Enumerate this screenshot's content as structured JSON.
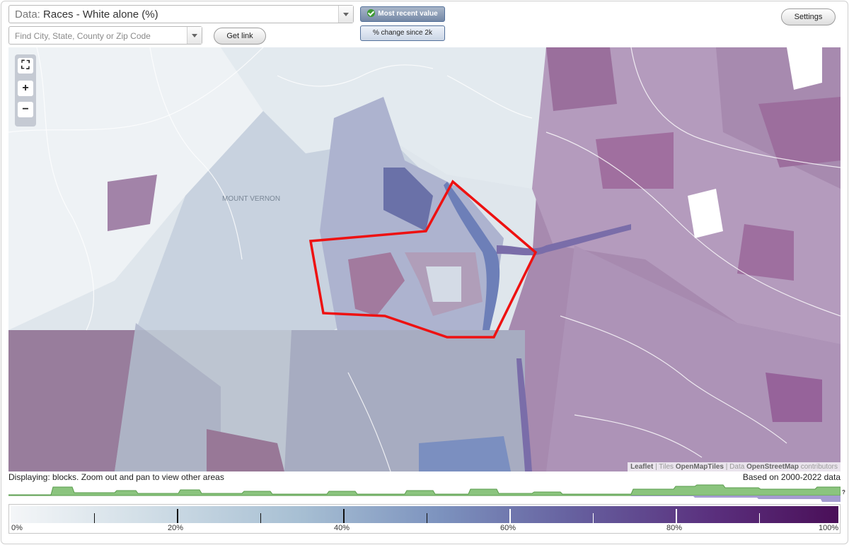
{
  "data_select": {
    "prefix": "Data:",
    "value": "Races - White alone (%)"
  },
  "search": {
    "placeholder": "Find City, State, County or Zip Code"
  },
  "buttons": {
    "get_link": "Get link",
    "settings": "Settings"
  },
  "value_toggle": {
    "selected": "Most recent value",
    "alternate": "% change since 2k"
  },
  "map": {
    "place_label": "MOUNT VERNON",
    "attribution": {
      "leaflet": "Leaflet",
      "tiles_label": "Tiles",
      "tiles": "OpenMapTiles",
      "data_label": "Data",
      "data": "OpenStreetMap",
      "contributors": "contributors"
    },
    "zoom": {
      "fullscreen": "⛶",
      "zoom_in": "+",
      "zoom_out": "−"
    },
    "highlight_color": "#ee1111"
  },
  "status": {
    "displaying": "Displaying: blocks. Zoom out and pan to view other areas",
    "based_on": "Based on 2000-2022 data"
  },
  "histogram_help": "?",
  "legend": {
    "labels": [
      "0%",
      "20%",
      "40%",
      "60%",
      "80%",
      "100%"
    ],
    "colors": {
      "low": "#f4f6f8",
      "mid": "#7c92be",
      "high": "#4a0f58"
    }
  }
}
